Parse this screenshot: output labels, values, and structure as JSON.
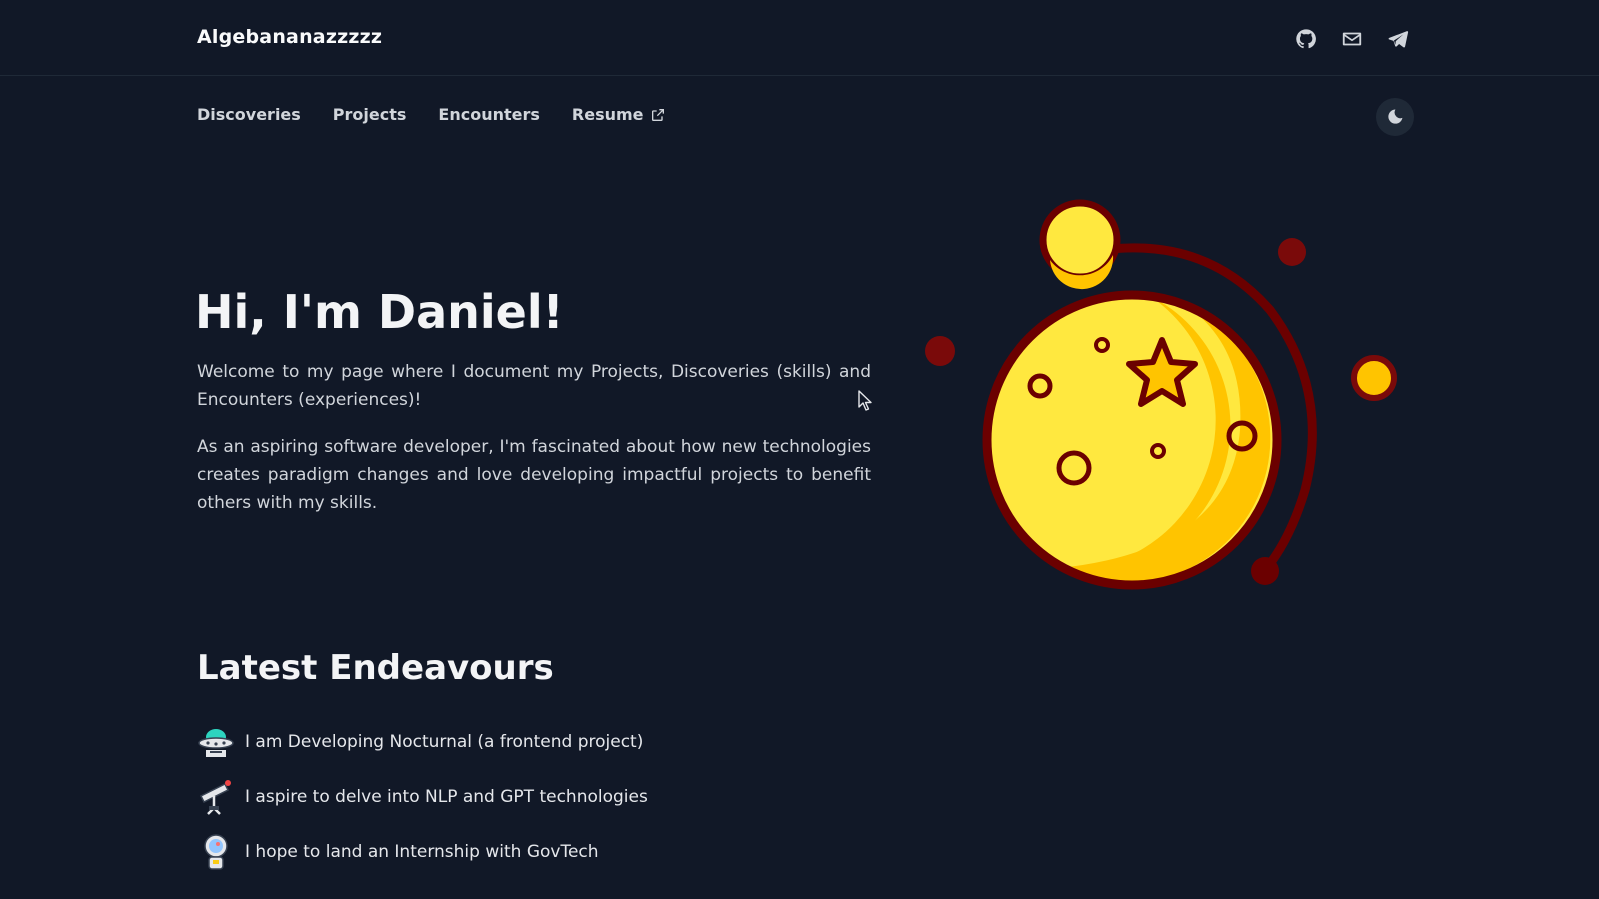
{
  "header": {
    "brand": "Algebananazzzzz",
    "social_icons": [
      "github-icon",
      "mail-icon",
      "telegram-icon"
    ]
  },
  "nav": {
    "items": [
      {
        "label": "Discoveries"
      },
      {
        "label": "Projects"
      },
      {
        "label": "Encounters"
      },
      {
        "label": "Resume",
        "icon": "external-link-icon"
      }
    ],
    "theme_toggle_icon": "moon-icon"
  },
  "hero": {
    "title": "Hi, I'm Daniel!",
    "paragraph_1": "Welcome to my page where I document my Projects, Discoveries (skills) and Encounters (experiences)!",
    "paragraph_2": "As an aspiring software developer, I'm fascinated about how new technologies creates paradigm changes and love developing impactful projects to benefit others with my skills."
  },
  "endeavours": {
    "title": "Latest Endeavours",
    "items": [
      {
        "text": "I am Developing Nocturnal (a frontend project)",
        "icon": "ufo-icon"
      },
      {
        "text": "I aspire to delve into NLP and GPT technologies",
        "icon": "telescope-icon"
      },
      {
        "text": "I hope to land an Internship with GovTech",
        "icon": "astronaut-icon"
      }
    ]
  },
  "colors": {
    "background": "#111827",
    "moon_yellow": "#ffe83f",
    "moon_shadow": "#ffc400",
    "outline": "#6b0000"
  }
}
